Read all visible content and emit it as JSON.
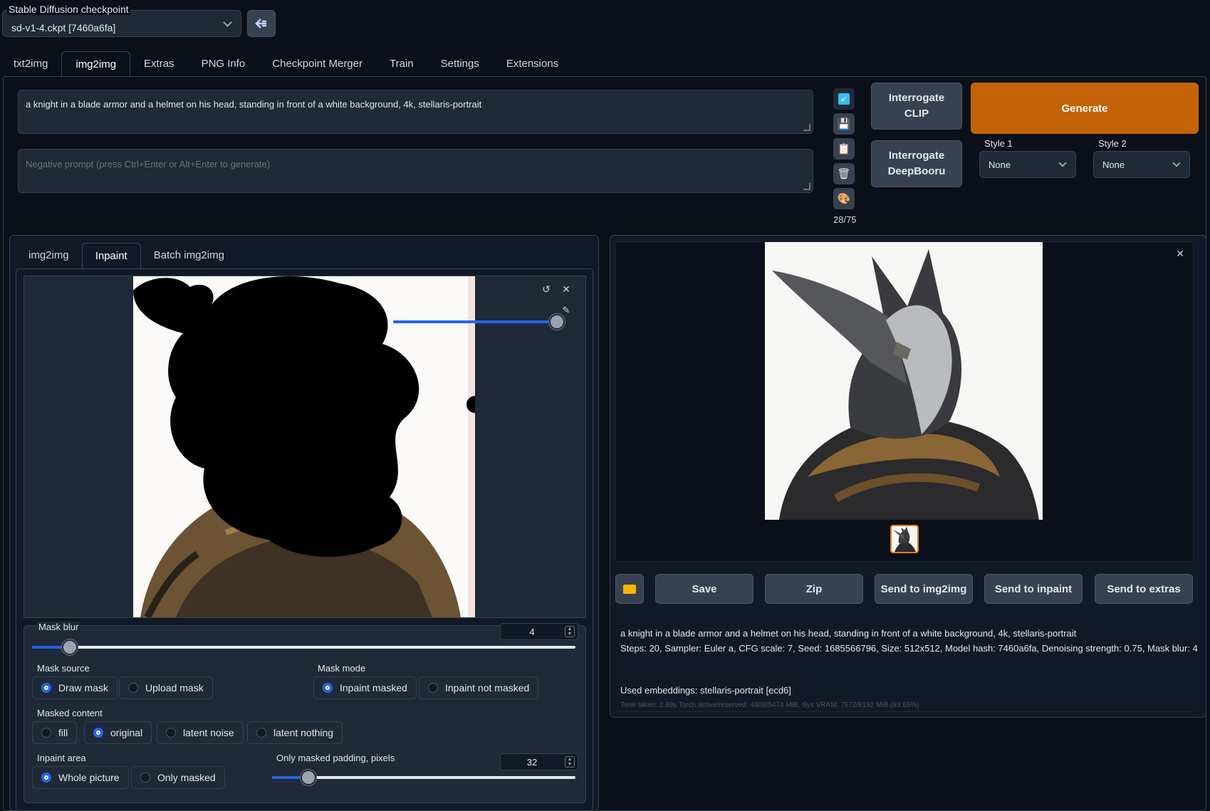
{
  "checkpoint": {
    "label": "Stable Diffusion checkpoint",
    "value": "sd-v1-4.ckpt [7460a6fa]"
  },
  "tabs": [
    "txt2img",
    "img2img",
    "Extras",
    "PNG Info",
    "Checkpoint Merger",
    "Train",
    "Settings",
    "Extensions"
  ],
  "active_tab": "img2img",
  "prompt": "a knight in a blade armor and a helmet on his head, standing in front of a white background, 4k, stellaris-portrait",
  "negative_placeholder": "Negative prompt (press Ctrl+Enter or Alt+Enter to generate)",
  "token_count": "28/75",
  "buttons": {
    "interrogate_clip": "Interrogate CLIP",
    "interrogate_deepbooru": "Interrogate DeepBooru",
    "generate": "Generate"
  },
  "styles": {
    "style1_label": "Style 1",
    "style1_value": "None",
    "style2_label": "Style 2",
    "style2_value": "None"
  },
  "subtabs": [
    "img2img",
    "Inpaint",
    "Batch img2img"
  ],
  "active_subtab": "Inpaint",
  "brush_size": 1.0,
  "mask_blur": {
    "label": "Mask blur",
    "value": "4",
    "fraction": 0.07
  },
  "mask_source": {
    "label": "Mask source",
    "options": [
      "Draw mask",
      "Upload mask"
    ],
    "selected": "Draw mask"
  },
  "mask_mode": {
    "label": "Mask mode",
    "options": [
      "Inpaint masked",
      "Inpaint not masked"
    ],
    "selected": "Inpaint masked"
  },
  "masked_content": {
    "label": "Masked content",
    "options": [
      "fill",
      "original",
      "latent noise",
      "latent nothing"
    ],
    "selected": "original"
  },
  "inpaint_area": {
    "label": "Inpaint area",
    "options": [
      "Whole picture",
      "Only masked"
    ],
    "selected": "Whole picture"
  },
  "padding": {
    "label": "Only masked padding, pixels",
    "value": "32",
    "fraction": 0.12
  },
  "output_buttons": {
    "save": "Save",
    "zip": "Zip",
    "send_img2img": "Send to img2img",
    "send_inpaint": "Send to inpaint",
    "send_extras": "Send to extras"
  },
  "output_info": {
    "prompt": "a knight in a blade armor and a helmet on his head, standing in front of a white background, 4k, stellaris-portrait",
    "params": "Steps: 20, Sampler: Euler a, CFG scale: 7, Seed: 1685566796, Size: 512x512, Model hash: 7460a6fa, Denoising strength: 0.75, Mask blur: 4",
    "embeddings": "Used embeddings: stellaris-portrait [ecd6]",
    "time": "Time taken: 2.89s  Torch active/reserved: 4808/5474 MiB, Sys VRAM: 7672/8192 MiB (93.65%)"
  },
  "colors": {
    "accent": "#2563eb",
    "generate": "#c4620a",
    "background": "#0b0f19",
    "panel": "#1f2937"
  }
}
